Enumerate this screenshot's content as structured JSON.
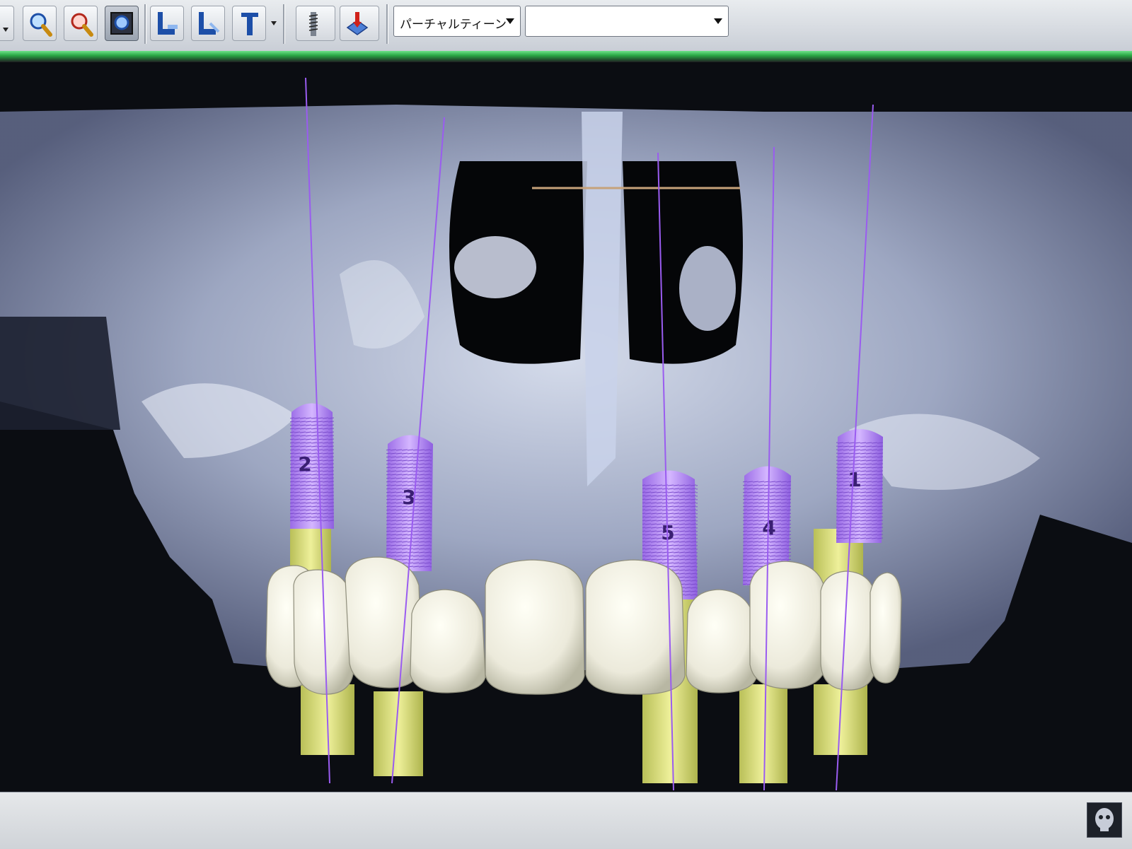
{
  "toolbar": {
    "buttons": [
      {
        "icon": "zoom-in-icon"
      },
      {
        "icon": "zoom-out-icon"
      },
      {
        "icon": "zoom-fit-icon",
        "active": true
      },
      {
        "icon": "implant-place-icon"
      },
      {
        "icon": "implant-angle-icon"
      },
      {
        "icon": "implant-tool-icon"
      },
      {
        "icon": "screw-icon"
      },
      {
        "icon": "delete-implant-icon"
      }
    ],
    "tooth_combo_value": "パーチャルティーン",
    "second_combo_value": ""
  },
  "viewport": {
    "implants": [
      {
        "label": "1"
      },
      {
        "label": "2"
      },
      {
        "label": "3"
      },
      {
        "label": "4"
      },
      {
        "label": "5"
      }
    ],
    "colors": {
      "bone": "#b8c2dc",
      "implant_thread": "#b68cf2",
      "abutment": "#d9de7a",
      "tooth": "#f2f1df",
      "guide_line": "#9a5cf0"
    }
  },
  "statusbar": {
    "thumbnail_icon": "skull-thumbnail-icon"
  }
}
